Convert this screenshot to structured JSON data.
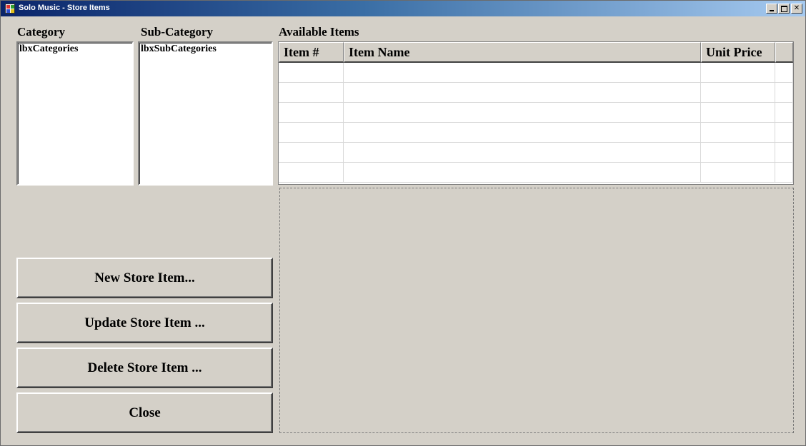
{
  "window": {
    "title": "Solo Music - Store Items",
    "controls": {
      "minimize": "minimize",
      "maximize": "maximize",
      "close_glyph": "✕"
    }
  },
  "category": {
    "label": "Category",
    "listbox_text": "lbxCategories"
  },
  "subcategory": {
    "label": "Sub-Category",
    "listbox_text": "lbxSubCategories"
  },
  "available_items": {
    "label": "Available Items",
    "columns": [
      "Item #",
      "Item Name",
      "Unit Price"
    ],
    "rows": [
      [
        "",
        "",
        ""
      ],
      [
        "",
        "",
        ""
      ],
      [
        "",
        "",
        ""
      ],
      [
        "",
        "",
        ""
      ],
      [
        "",
        "",
        ""
      ],
      [
        "",
        "",
        ""
      ]
    ]
  },
  "buttons": {
    "new_item": "New Store Item...",
    "update_item": "Update Store Item ...",
    "delete_item": "Delete Store Item ...",
    "close": "Close"
  }
}
